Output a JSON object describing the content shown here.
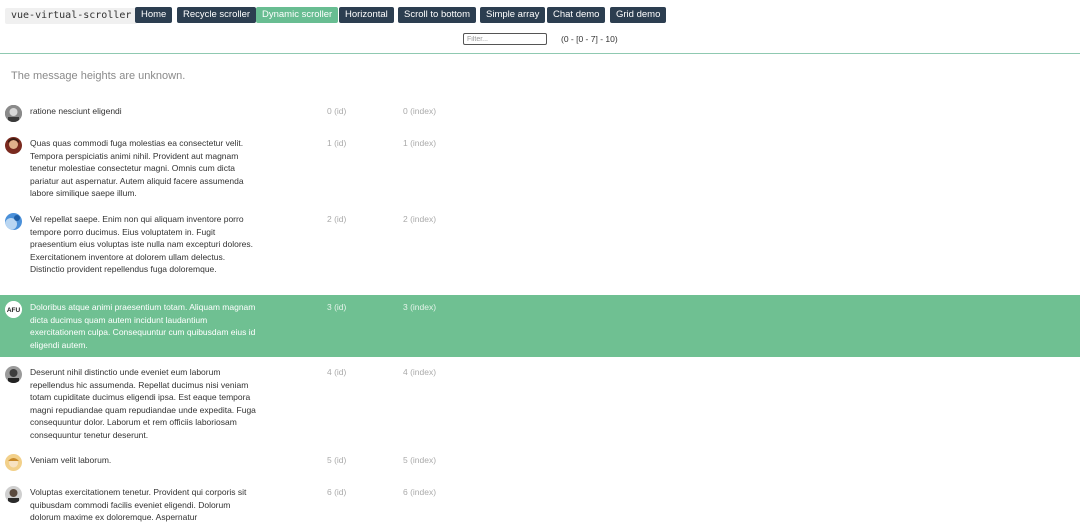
{
  "brand": "vue-virtual-scroller",
  "nav": [
    {
      "label": "Home"
    },
    {
      "label": "Recycle scroller"
    },
    {
      "label": "Dynamic scroller"
    },
    {
      "label": "Horizontal"
    },
    {
      "label": "Scroll to bottom"
    },
    {
      "label": "Simple array"
    },
    {
      "label": "Chat demo"
    },
    {
      "label": "Grid demo"
    }
  ],
  "filter": {
    "placeholder": "Filter...",
    "value": ""
  },
  "range": "(0 - [0 - 7] - 10)",
  "hint": "The message heights are unknown.",
  "colors": {
    "accent": "#68bd92",
    "selected_row": "#6fc092",
    "nav": "#2c3e50"
  },
  "rows": [
    {
      "text": "ratione nesciunt eligendi",
      "id": "0 (id)",
      "index": "0 (index)",
      "avatar": "avatar-photo-icon"
    },
    {
      "text": "Quas quas commodi fuga molestias ea consectetur velit. Tempora perspiciatis animi nihil. Provident aut magnam tenetur molestiae consectetur magni. Omnis cum dicta pariatur aut aspernatur. Autem aliquid facere assumenda labore similique saepe illum.",
      "id": "1 (id)",
      "index": "1 (index)",
      "avatar": "avatar-photo-icon"
    },
    {
      "text": "Vel repellat saepe. Enim non qui aliquam inventore porro tempore porro ducimus. Eius voluptatem in. Fugit praesentium eius voluptas iste nulla nam excepturi dolores. Exercitationem inventore at dolorem ullam delectus. Distinctio provident repellendus fuga doloremque.",
      "id": "2 (id)",
      "index": "2 (index)",
      "avatar": "avatar-photo-icon"
    },
    {
      "text": "Doloribus atque animi praesentium totam. Aliquam magnam dicta ducimus quam autem incidunt laudantium exercitationem culpa. Consequuntur cum quibusdam eius id eligendi autem.",
      "id": "3 (id)",
      "index": "3 (index)",
      "avatar": "avatar-photo-icon",
      "avatar_text": "AFU",
      "selected": true
    },
    {
      "text": "Deserunt nihil distinctio unde eveniet eum laborum repellendus hic assumenda. Repellat ducimus nisi veniam totam cupiditate ducimus eligendi ipsa. Est eaque tempora magni repudiandae quam repudiandae unde expedita. Fuga consequuntur dolor. Laborum et rem officiis laboriosam consequuntur tenetur deserunt.",
      "id": "4 (id)",
      "index": "4 (index)",
      "avatar": "avatar-photo-icon"
    },
    {
      "text": "Veniam velit laborum.",
      "id": "5 (id)",
      "index": "5 (index)",
      "avatar": "avatar-photo-icon"
    },
    {
      "text": "Voluptas exercitationem tenetur. Provident qui corporis sit quibusdam commodi facilis eveniet eligendi. Dolorum dolorum maxime ex doloremque. Aspernatur",
      "id": "6 (id)",
      "index": "6 (index)",
      "avatar": "avatar-photo-icon"
    }
  ]
}
